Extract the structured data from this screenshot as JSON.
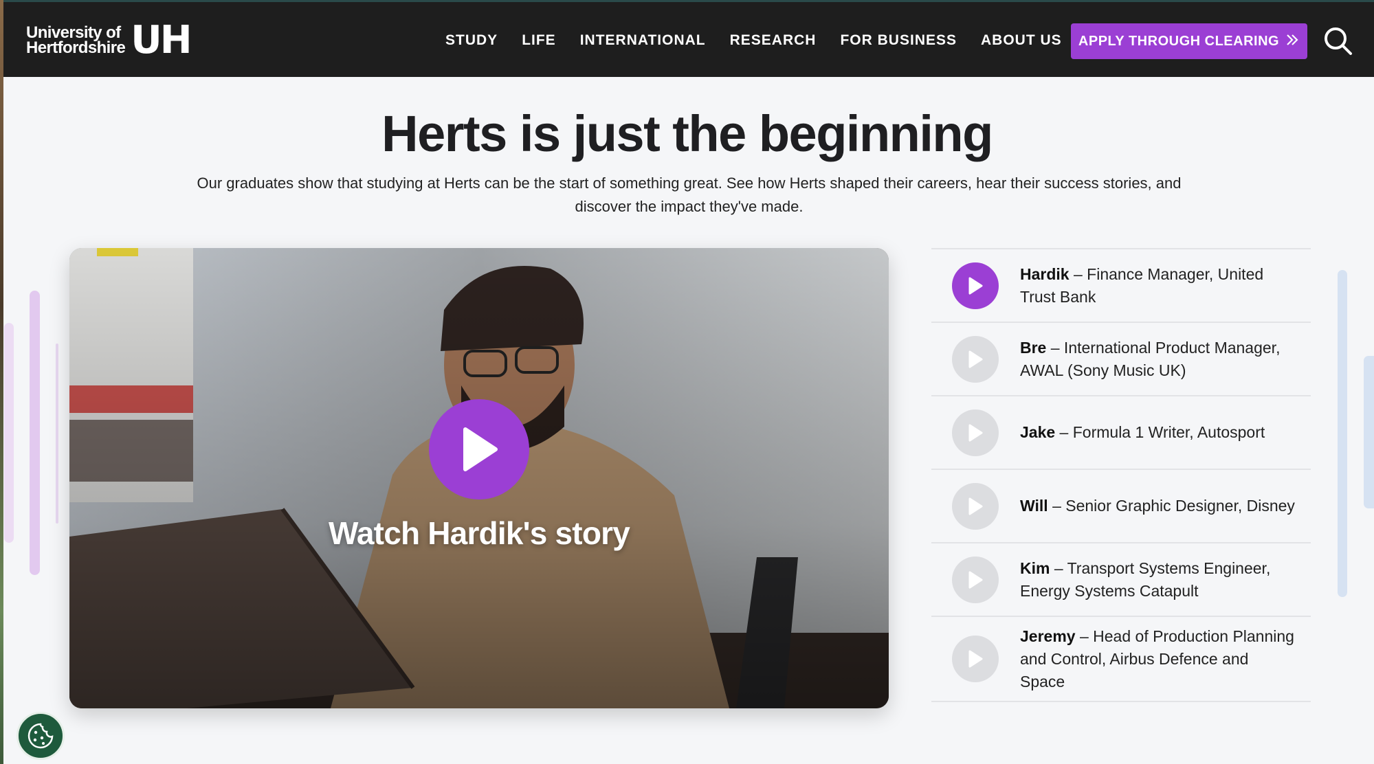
{
  "header": {
    "logo_line1": "University of",
    "logo_line2": "Hertfordshire",
    "logo_mark": "UH",
    "nav": [
      "STUDY",
      "LIFE",
      "INTERNATIONAL",
      "RESEARCH",
      "FOR BUSINESS",
      "ABOUT US"
    ],
    "cta_label": "APPLY THROUGH CLEARING",
    "cta_icon": "double-chevron-right-icon",
    "search_icon": "search-icon"
  },
  "main": {
    "title": "Herts is just the beginning",
    "subtitle": "Our graduates show that studying at Herts can be the start of something great. See how Herts shaped their careers, hear their success stories, and discover the impact they've made."
  },
  "video": {
    "label": "Watch Hardik's story",
    "play_icon": "play-icon"
  },
  "stories": [
    {
      "name": "Hardik",
      "role": " – Finance Manager, United Trust Bank",
      "active": true
    },
    {
      "name": "Bre",
      "role": " – International Product Manager, AWAL (Sony Music UK)",
      "active": false
    },
    {
      "name": "Jake",
      "role": " – Formula 1 Writer, Autosport",
      "active": false
    },
    {
      "name": "Will",
      "role": " – Senior Graphic Designer, Disney",
      "active": false
    },
    {
      "name": "Kim",
      "role": " – Transport Systems Engineer, Energy Systems Catapult",
      "active": false
    },
    {
      "name": "Jeremy",
      "role": " – Head of Production Planning and Control, Airbus Defence and Space",
      "active": false
    }
  ],
  "cookie": {
    "icon": "cookie-icon"
  },
  "colors": {
    "accent": "#9b3fd4",
    "header_bg": "#1e1e1e",
    "inactive_play": "#dcdde0"
  }
}
